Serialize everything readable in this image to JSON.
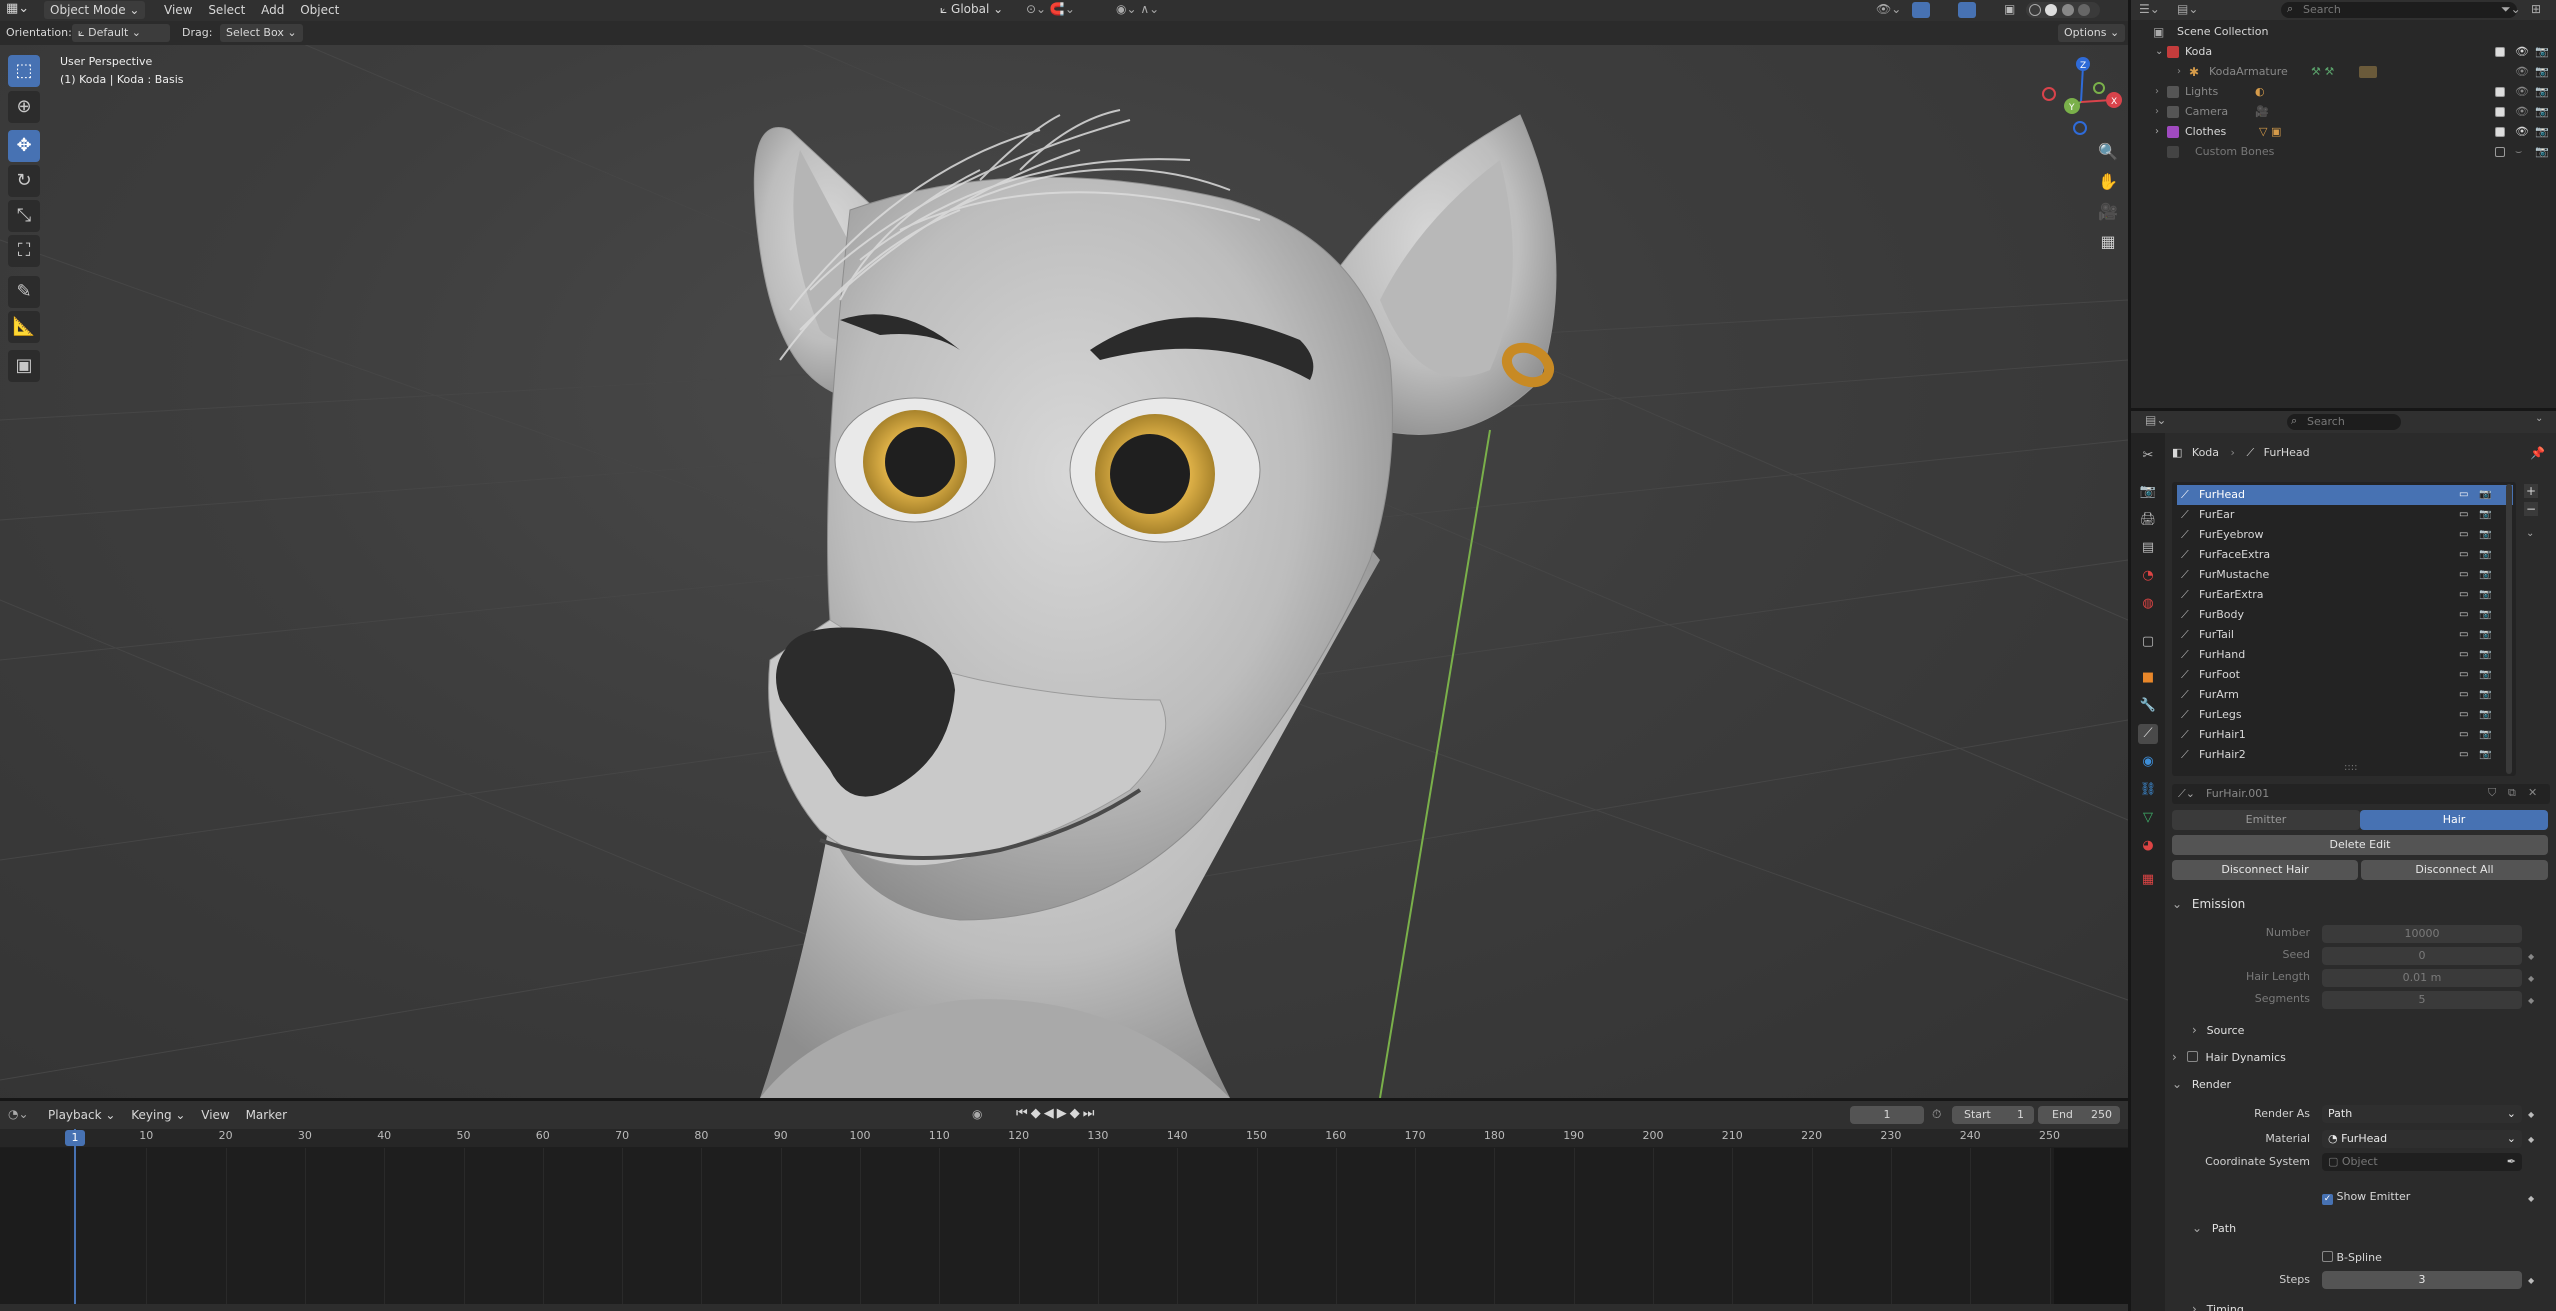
{
  "topbar": {
    "editor_icon": "viewport-icon",
    "mode": "Object Mode",
    "menus": [
      "View",
      "Select",
      "Add",
      "Object"
    ],
    "transform_orientation": "Global",
    "options": "Options"
  },
  "toolheader": {
    "orientation_label": "Orientation:",
    "orientation_value": "Default",
    "drag_label": "Drag:",
    "drag_value": "Select Box"
  },
  "viewport": {
    "perspective": "User Perspective",
    "object_info": "(1) Koda | Koda : Basis",
    "background": "#3d3d3d"
  },
  "tools": [
    "select-box-icon",
    "cursor-icon",
    "move-icon",
    "rotate-icon",
    "scale-icon",
    "transform-icon",
    "annotate-icon",
    "measure-icon",
    "add-cube-icon"
  ],
  "gizmo": {
    "x": "X",
    "y": "Y",
    "z": "Z"
  },
  "outliner": {
    "search_placeholder": "Search",
    "root": "Scene Collection",
    "items": [
      {
        "label": "Koda",
        "icon": "collection-icon"
      },
      {
        "label": "KodaArmature",
        "icon": "armature-icon"
      },
      {
        "label": "Lights",
        "icon": "collection-icon"
      },
      {
        "label": "Camera",
        "icon": "collection-icon"
      },
      {
        "label": "Clothes",
        "icon": "collection-icon"
      },
      {
        "label": "Custom Bones",
        "icon": "collection-icon"
      }
    ]
  },
  "properties": {
    "search_placeholder": "Search",
    "breadcrumb": [
      "Koda",
      "FurHead"
    ],
    "particle_systems": [
      "FurHead",
      "FurEar",
      "FurEyebrow",
      "FurFaceExtra",
      "FurMustache",
      "FurEarExtra",
      "FurBody",
      "FurTail",
      "FurHand",
      "FurFoot",
      "FurArm",
      "FurLegs",
      "FurHair1",
      "FurHair2"
    ],
    "settings_name": "FurHair.001",
    "type_tabs": [
      "Emitter",
      "Hair"
    ],
    "buttons": {
      "delete_edit": "Delete Edit",
      "disconnect_hair": "Disconnect Hair",
      "disconnect_all": "Disconnect All"
    },
    "emission": {
      "title": "Emission",
      "number_label": "Number",
      "number": "10000",
      "seed_label": "Seed",
      "seed": "0",
      "hair_length_label": "Hair Length",
      "hair_length": "0.01 m",
      "segments_label": "Segments",
      "segments": "5"
    },
    "source": "Source",
    "hair_dynamics": "Hair Dynamics",
    "render": {
      "title": "Render",
      "render_as_label": "Render As",
      "render_as": "Path",
      "material_label": "Material",
      "material": "FurHead",
      "coord_label": "Coordinate System",
      "coord_placeholder": "Object",
      "show_emitter": "Show Emitter"
    },
    "path": {
      "title": "Path",
      "bspline": "B-Spline",
      "steps_label": "Steps",
      "steps": "3",
      "timing": "Timing"
    }
  },
  "timeline": {
    "menus": [
      "Playback",
      "Keying",
      "View",
      "Marker"
    ],
    "current_frame": "1",
    "start_label": "Start",
    "start": "1",
    "end_label": "End",
    "end": "250",
    "ticks": [
      "1",
      "10",
      "20",
      "30",
      "40",
      "50",
      "60",
      "70",
      "80",
      "90",
      "100",
      "110",
      "120",
      "130",
      "140",
      "150",
      "160",
      "170",
      "180",
      "190",
      "200",
      "210",
      "220",
      "230",
      "240",
      "250"
    ],
    "playhead": "1"
  },
  "colors": {
    "accent": "#4772b3",
    "selected_row": "#4772b3",
    "z_axis_line": "#7ab04a"
  }
}
